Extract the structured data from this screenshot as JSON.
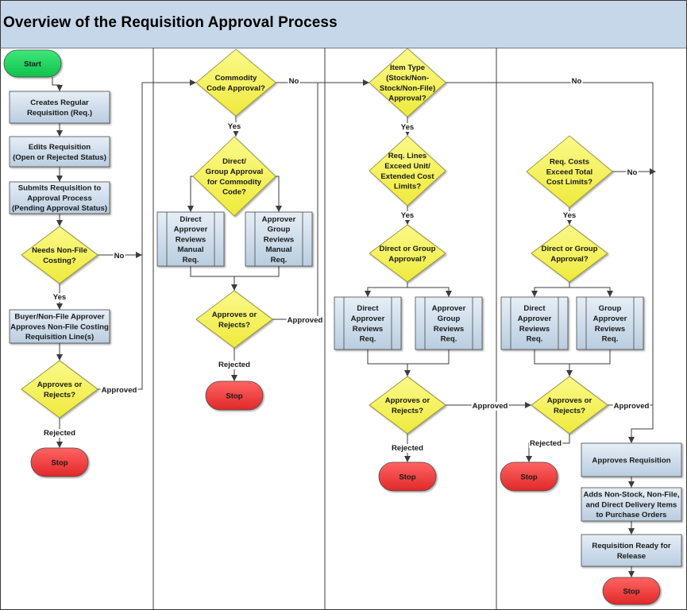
{
  "title": "Overview of the Requisition Approval Process",
  "colors": {
    "header_bg": "#c5d7e8",
    "process_fill": "#c9daea",
    "decision_fill": "#f5f25a",
    "start_fill": "#19d45a",
    "stop_fill": "#ef3b3b",
    "line": "#3c3c3c"
  },
  "lanes": 4,
  "nodes": {
    "start": {
      "type": "terminal-start",
      "label": [
        "Start"
      ]
    },
    "creates_req": {
      "type": "process",
      "label": [
        "Creates Regular",
        "Requisition (Req.)"
      ]
    },
    "edits_req": {
      "type": "process",
      "label": [
        "Edits Requisition",
        "(Open or Rejected Status)"
      ]
    },
    "submits_req": {
      "type": "process",
      "label": [
        "Submits Requisition to",
        "Approval Process",
        "(Pending Approval Status)"
      ]
    },
    "needs_nonfile": {
      "type": "decision",
      "label": [
        "Needs Non-File",
        "Costing?"
      ]
    },
    "buyer_approves": {
      "type": "process",
      "label": [
        "Buyer/Non-File Approver",
        "Approves Non-File Costing",
        "Requisition Line(s)"
      ]
    },
    "lane1_approves": {
      "type": "decision",
      "label": [
        "Approves or",
        "Rejects?"
      ]
    },
    "lane1_stop": {
      "type": "terminal-stop",
      "label": [
        "Stop"
      ]
    },
    "commodity_q": {
      "type": "decision",
      "label": [
        "Commodity",
        "Code Approval?"
      ]
    },
    "direct_group_commodity": {
      "type": "decision",
      "label": [
        "Direct/",
        "Group Approval",
        "for Commodity",
        "Code?"
      ]
    },
    "direct_manual": {
      "type": "subprocess",
      "label": [
        "Direct",
        "Approver",
        "Reviews",
        "Manual",
        "Req."
      ]
    },
    "group_manual": {
      "type": "subprocess",
      "label": [
        "Approver",
        "Group",
        "Reviews",
        "Manual",
        "Req."
      ]
    },
    "lane2_approves": {
      "type": "decision",
      "label": [
        "Approves or",
        "Rejects?"
      ]
    },
    "lane2_stop": {
      "type": "terminal-stop",
      "label": [
        "Stop"
      ]
    },
    "item_type_q": {
      "type": "decision",
      "label": [
        "Item Type",
        "(Stock/Non-",
        "Stock/Non-File)",
        "Approval?"
      ]
    },
    "req_lines_q": {
      "type": "decision",
      "label": [
        "Req. Lines",
        "Exceed Unit/",
        "Extended Cost",
        "Limits?"
      ]
    },
    "lane3_direct_group": {
      "type": "decision",
      "label": [
        "Direct or Group",
        "Approval?"
      ]
    },
    "lane3_direct": {
      "type": "subprocess",
      "label": [
        "Direct",
        "Approver",
        "Reviews",
        "Req."
      ]
    },
    "lane3_group": {
      "type": "subprocess",
      "label": [
        "Approver",
        "Group",
        "Reviews",
        "Req."
      ]
    },
    "lane3_approves": {
      "type": "decision",
      "label": [
        "Approves or",
        "Rejects?"
      ]
    },
    "lane3_stop": {
      "type": "terminal-stop",
      "label": [
        "Stop"
      ]
    },
    "req_costs_q": {
      "type": "decision",
      "label": [
        "Req. Costs",
        "Exceed Total",
        "Cost Limits?"
      ]
    },
    "lane4_direct_group": {
      "type": "decision",
      "label": [
        "Direct or Group",
        "Approval?"
      ]
    },
    "lane4_direct": {
      "type": "subprocess",
      "label": [
        "Direct",
        "Approver",
        "Reviews",
        "Req."
      ]
    },
    "lane4_group": {
      "type": "subprocess",
      "label": [
        "Group",
        "Approver",
        "Reviews",
        "Req."
      ]
    },
    "lane4_approves": {
      "type": "decision",
      "label": [
        "Approves or",
        "Rejects?"
      ]
    },
    "lane4_stop": {
      "type": "terminal-stop",
      "label": [
        "Stop"
      ]
    },
    "approves_req": {
      "type": "process",
      "label": [
        "Approves Requisition"
      ]
    },
    "adds_items": {
      "type": "process",
      "label": [
        "Adds Non-Stock, Non-File,",
        "and Direct Delivery Items",
        "to Purchase Orders"
      ]
    },
    "ready_release": {
      "type": "process",
      "label": [
        "Requisition Ready for",
        "Release"
      ]
    },
    "final_stop": {
      "type": "terminal-stop",
      "label": [
        "Stop"
      ]
    }
  },
  "edge_labels": {
    "yes": "Yes",
    "no": "No",
    "approved": "Approved",
    "rejected": "Rejected"
  }
}
